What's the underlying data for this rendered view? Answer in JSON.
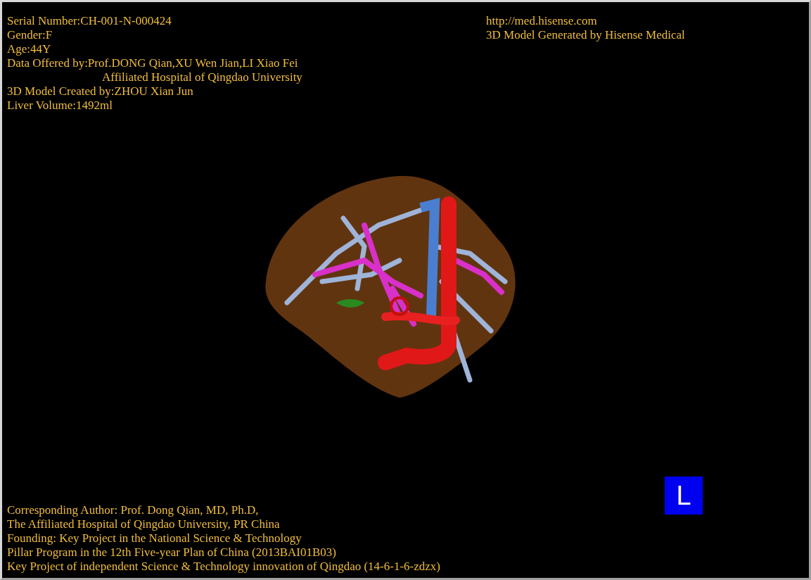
{
  "patient_info": [
    {
      "kind": "line",
      "text": "Serial Number:CH-001-N-000424"
    },
    {
      "kind": "line",
      "text": "Gender:F"
    },
    {
      "kind": "line",
      "text": "Age:44Y"
    },
    {
      "kind": "line",
      "text": "Data Offered by:Prof.DONG Qian,XU Wen Jian,LI Xiao Fei"
    },
    {
      "kind": "continuation",
      "text": "Affiliated Hospital of Qingdao University"
    },
    {
      "kind": "line",
      "text": "3D Model Created by:ZHOU Xian Jun"
    },
    {
      "kind": "line",
      "text": "Liver Volume:1492ml"
    }
  ],
  "source_info": [
    "http://med.hisense.com",
    "3D Model Generated by Hisense Medical"
  ],
  "credits": [
    "Corresponding Author: Prof. Dong Qian, MD, Ph.D,",
    "The Affiliated Hospital of Qingdao University, PR China",
    "Founding: Key Project in the National Science & Technology",
    "Pillar Program in the 12th Five-year Plan of China (2013BAI01B03)",
    "Key Project of independent Science & Technology innovation of Qingdao (14-6-1-6-zdzx)"
  ],
  "orientation_marker": "L"
}
